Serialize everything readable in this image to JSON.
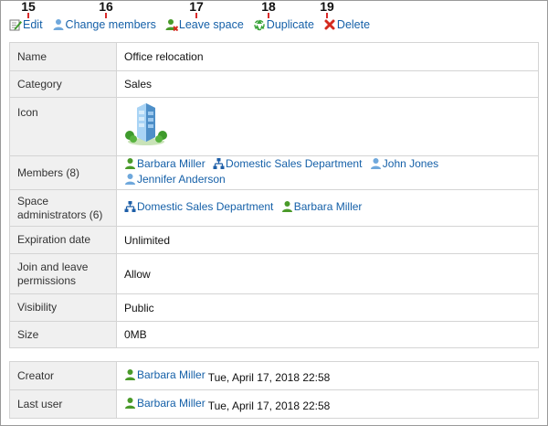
{
  "callouts": [
    "15",
    "16",
    "17",
    "18",
    "19"
  ],
  "toolbar": {
    "edit": "Edit",
    "change_members": "Change members",
    "leave_space": "Leave space",
    "duplicate": "Duplicate",
    "delete": "Delete"
  },
  "details": {
    "name": {
      "label": "Name",
      "value": "Office relocation"
    },
    "category": {
      "label": "Category",
      "value": "Sales"
    },
    "icon": {
      "label": "Icon",
      "icon_name": "building-icon"
    },
    "members": {
      "label": "Members (8)",
      "items": [
        {
          "name": "Barbara Miller",
          "type": "user"
        },
        {
          "name": "Domestic Sales Department",
          "type": "organization"
        },
        {
          "name": "John Jones",
          "type": "user-blue"
        },
        {
          "name": "Jennifer Anderson",
          "type": "user-blue"
        }
      ]
    },
    "space_admins": {
      "label": "Space administrators (6)",
      "items": [
        {
          "name": "Domestic Sales Department",
          "type": "organization"
        },
        {
          "name": "Barbara Miller",
          "type": "user"
        }
      ]
    },
    "expiration": {
      "label": "Expiration date",
      "value": "Unlimited"
    },
    "join_leave": {
      "label": "Join and leave permissions",
      "value": "Allow"
    },
    "visibility": {
      "label": "Visibility",
      "value": "Public"
    },
    "size": {
      "label": "Size",
      "value": "0MB"
    }
  },
  "history": {
    "creator": {
      "label": "Creator",
      "user": "Barbara Miller",
      "time": "Tue, April 17, 2018 22:58"
    },
    "last_user": {
      "label": "Last user",
      "user": "Barbara Miller",
      "time": "Tue, April 17, 2018 22:58"
    }
  },
  "colors": {
    "link": "#1560a8",
    "callout_stem": "#d92b2b",
    "label_bg": "#f0f0f0",
    "border": "#d4d4d4"
  }
}
